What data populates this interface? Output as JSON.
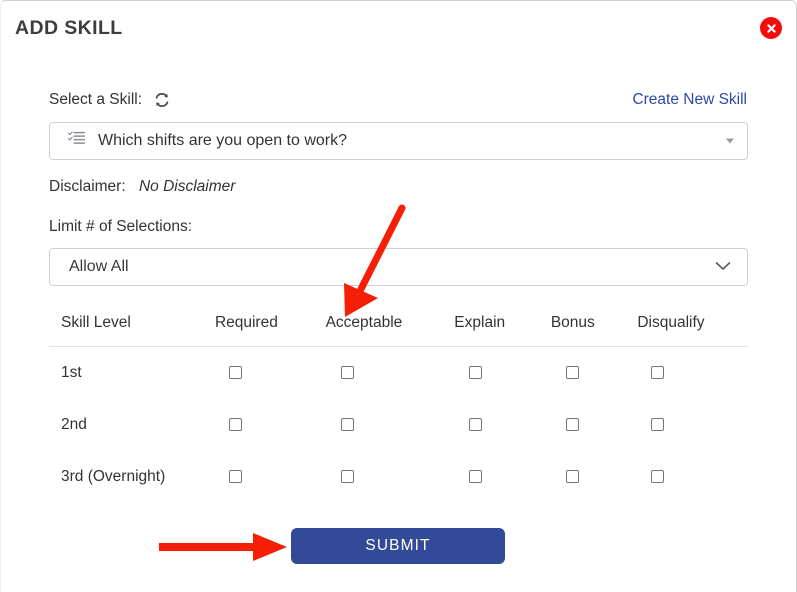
{
  "modal": {
    "title": "ADD SKILL",
    "close_icon": "close-circle-icon"
  },
  "form": {
    "select_skill_label": "Select a Skill:",
    "refresh_icon": "refresh-icon",
    "create_new_skill_link": "Create New Skill",
    "skill_select": {
      "icon": "checklist-icon",
      "value": "Which shifts are you open to work?",
      "caret_icon": "caret-down-icon"
    },
    "disclaimer_label": "Disclaimer:",
    "disclaimer_value": "No Disclaimer",
    "limit_label": "Limit # of Selections:",
    "limit_select": {
      "value": "Allow All",
      "caret_icon": "chevron-down-icon"
    }
  },
  "table": {
    "headers": {
      "level": "Skill Level",
      "required": "Required",
      "acceptable": "Acceptable",
      "explain": "Explain",
      "bonus": "Bonus",
      "disqualify": "Disqualify"
    },
    "rows": [
      {
        "level": "1st",
        "required": false,
        "acceptable": false,
        "explain": false,
        "bonus": false,
        "disqualify": false
      },
      {
        "level": "2nd",
        "required": false,
        "acceptable": false,
        "explain": false,
        "bonus": false,
        "disqualify": false
      },
      {
        "level": "3rd (Overnight)",
        "required": false,
        "acceptable": false,
        "explain": false,
        "bonus": false,
        "disqualify": false
      }
    ]
  },
  "actions": {
    "submit_label": "SUBMIT"
  },
  "annotations": {
    "arrow_color": "#f41f05",
    "arrow_to_acceptable": "red-arrow-pointing-to-acceptable-column",
    "arrow_to_submit": "red-arrow-pointing-to-submit-button"
  },
  "colors": {
    "link": "#2f48a8",
    "submit_background": "#334a99",
    "close_background": "#f20d0d",
    "annotation_red": "#f41f05"
  }
}
